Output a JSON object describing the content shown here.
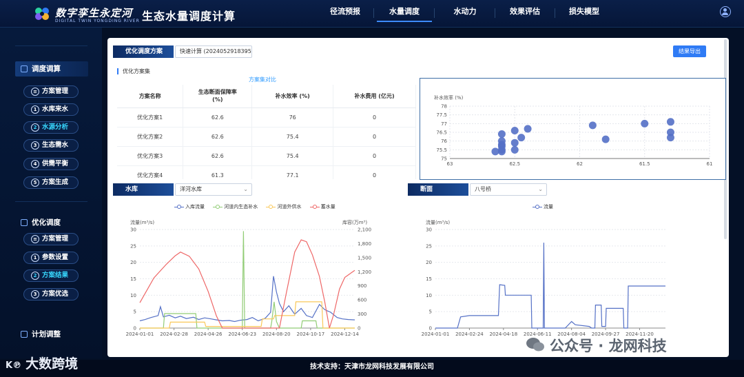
{
  "header": {
    "logo_cn": "数字孪生永定河",
    "logo_en": "DIGITAL TWIN  YONGDING RIVER",
    "system_title": "生态水量调度计算",
    "nav": [
      {
        "label": "径流预报",
        "active": false
      },
      {
        "label": "水量调度",
        "active": true
      },
      {
        "label": "水动力",
        "active": false
      },
      {
        "label": "效果评估",
        "active": false
      },
      {
        "label": "损失模型",
        "active": false
      }
    ]
  },
  "sidebar": {
    "groups": [
      {
        "label": "调度调算",
        "items": [
          {
            "badge": "",
            "label": "方案管理"
          },
          {
            "badge": "1",
            "label": "水库来水"
          },
          {
            "badge": "2",
            "label": "水源分析"
          },
          {
            "badge": "3",
            "label": "生态需水"
          },
          {
            "badge": "4",
            "label": "供需平衡"
          },
          {
            "badge": "5",
            "label": "方案生成"
          }
        ]
      },
      {
        "label": "优化调度",
        "items": [
          {
            "badge": "",
            "label": "方案管理"
          },
          {
            "badge": "1",
            "label": "参数设置"
          },
          {
            "badge": "2",
            "label": "方案结果"
          },
          {
            "badge": "3",
            "label": "方案优选"
          }
        ]
      },
      {
        "label": "计划调整",
        "items": []
      }
    ]
  },
  "main": {
    "scheme_tag": "优化调度方案",
    "scheme_select": "快速计算 (20240529183951",
    "export_button": "结果导出",
    "scheme_set_title": "优化方案集",
    "compare_link": "方案集对比",
    "table": {
      "headers": [
        "方案名称",
        "生态断面保障率\n(%)",
        "补水效率 (%)",
        "补水费用 (亿元)"
      ],
      "rows": [
        [
          "优化方案1",
          "62.6",
          "76",
          "0"
        ],
        [
          "优化方案2",
          "62.6",
          "75.4",
          "0"
        ],
        [
          "优化方案3",
          "62.6",
          "75.4",
          "0"
        ],
        [
          "优化方案4",
          "61.3",
          "77.1",
          "0"
        ]
      ]
    },
    "reservoir_tag": "水库",
    "reservoir_select": "洋河水库",
    "section_tag": "断面",
    "section_select": "八号桥"
  },
  "chart_data": [
    {
      "type": "scatter",
      "ylabel": "补水效率 (%)",
      "xlim": [
        63,
        61
      ],
      "ylim": [
        75,
        78
      ],
      "x_ticks": [
        "63",
        "62.5",
        "62",
        "61.5",
        "61"
      ],
      "y_ticks": [
        "75",
        "75.5",
        "76",
        "76.5",
        "77",
        "77.5",
        "78"
      ],
      "points": [
        {
          "x": 62.6,
          "y": 75.4
        },
        {
          "x": 62.6,
          "y": 75.5
        },
        {
          "x": 62.6,
          "y": 75.7
        },
        {
          "x": 62.6,
          "y": 75.8
        },
        {
          "x": 62.6,
          "y": 76.0
        },
        {
          "x": 62.6,
          "y": 76.4
        },
        {
          "x": 62.65,
          "y": 75.4
        },
        {
          "x": 62.5,
          "y": 75.5
        },
        {
          "x": 62.5,
          "y": 75.9
        },
        {
          "x": 62.5,
          "y": 76.6
        },
        {
          "x": 62.45,
          "y": 76.2
        },
        {
          "x": 62.4,
          "y": 76.7
        },
        {
          "x": 61.9,
          "y": 76.9
        },
        {
          "x": 61.8,
          "y": 76.1
        },
        {
          "x": 61.5,
          "y": 77.0
        },
        {
          "x": 61.3,
          "y": 77.1
        },
        {
          "x": 61.3,
          "y": 76.5
        },
        {
          "x": 61.3,
          "y": 76.2
        }
      ]
    },
    {
      "type": "line",
      "ylabel": "流量(m³/s)",
      "ylabel_right": "库容(万m³)",
      "ylim": [
        0,
        30
      ],
      "ylim_right": [
        0,
        2100
      ],
      "y_ticks": [
        "0",
        "5",
        "10",
        "15",
        "20",
        "25",
        "30"
      ],
      "y_ticks_right": [
        "0",
        "300",
        "600",
        "900",
        "1,200",
        "1,500",
        "1,800",
        "2,100"
      ],
      "x_ticks": [
        "2024-01-01",
        "2024-02-28",
        "2024-04-26",
        "2024-06-23",
        "2024-08-20",
        "2024-10-17",
        "2024-12-14"
      ],
      "x_range": [
        "2024-01-01",
        "2024-12-31"
      ],
      "series": [
        {
          "name": "入库流量",
          "color": "#5470c6",
          "axis": "left",
          "points": [
            [
              "2024-01-01",
              2.2
            ],
            [
              "2024-01-10",
              2.6
            ],
            [
              "2024-01-20",
              3.2
            ],
            [
              "2024-02-01",
              3.8
            ],
            [
              "2024-02-05",
              6.5
            ],
            [
              "2024-02-10",
              3.4
            ],
            [
              "2024-02-20",
              3.9
            ],
            [
              "2024-03-01",
              3.1
            ],
            [
              "2024-03-10",
              3.6
            ],
            [
              "2024-03-20",
              2.9
            ],
            [
              "2024-04-01",
              3.3
            ],
            [
              "2024-04-10",
              2.6
            ],
            [
              "2024-04-20",
              3.1
            ],
            [
              "2024-05-01",
              2.8
            ],
            [
              "2024-05-10",
              2.5
            ],
            [
              "2024-05-20",
              2.2
            ],
            [
              "2024-06-01",
              2.3
            ],
            [
              "2024-06-10",
              2.0
            ],
            [
              "2024-06-20",
              2.4
            ],
            [
              "2024-07-01",
              2.6
            ],
            [
              "2024-07-10",
              3.2
            ],
            [
              "2024-07-20",
              2.2
            ],
            [
              "2024-08-01",
              3.0
            ],
            [
              "2024-08-10",
              4.8
            ],
            [
              "2024-08-15",
              15.8
            ],
            [
              "2024-08-20",
              11.0
            ],
            [
              "2024-08-25",
              7.5
            ],
            [
              "2024-09-01",
              5.0
            ],
            [
              "2024-09-10",
              6.8
            ],
            [
              "2024-09-20",
              4.2
            ],
            [
              "2024-10-01",
              6.0
            ],
            [
              "2024-10-10",
              3.8
            ],
            [
              "2024-10-20",
              3.2
            ],
            [
              "2024-11-01",
              7.2
            ],
            [
              "2024-11-10",
              5.6
            ],
            [
              "2024-11-20",
              4.8
            ],
            [
              "2024-12-01",
              3.2
            ],
            [
              "2024-12-10",
              2.8
            ],
            [
              "2024-12-20",
              2.6
            ],
            [
              "2024-12-31",
              2.5
            ]
          ]
        },
        {
          "name": "河道内生态补水",
          "color": "#91cc75",
          "axis": "left",
          "points": [
            [
              "2024-01-01",
              0
            ],
            [
              "2024-02-10",
              0
            ],
            [
              "2024-02-12",
              4.4
            ],
            [
              "2024-04-05",
              4.4
            ],
            [
              "2024-04-07",
              0
            ],
            [
              "2024-06-23",
              0
            ],
            [
              "2024-06-25",
              29.5
            ],
            [
              "2024-06-27",
              0
            ],
            [
              "2024-08-10",
              0
            ],
            [
              "2024-08-12",
              2.0
            ],
            [
              "2024-08-16",
              8.0
            ],
            [
              "2024-08-20",
              2.0
            ],
            [
              "2024-08-25",
              0
            ],
            [
              "2024-10-01",
              0
            ],
            [
              "2024-10-03",
              2.2
            ],
            [
              "2024-10-26",
              2.2
            ],
            [
              "2024-10-28",
              0
            ],
            [
              "2024-12-31",
              0
            ]
          ]
        },
        {
          "name": "河道外供水",
          "color": "#fac858",
          "axis": "left",
          "points": [
            [
              "2024-01-01",
              0
            ],
            [
              "2024-02-20",
              0
            ],
            [
              "2024-02-22",
              1.8
            ],
            [
              "2024-04-20",
              1.8
            ],
            [
              "2024-04-22",
              0.5
            ],
            [
              "2024-07-25",
              0.5
            ],
            [
              "2024-07-27",
              2.8
            ],
            [
              "2024-08-15",
              2.8
            ],
            [
              "2024-08-17",
              3.8
            ],
            [
              "2024-09-20",
              3.8
            ],
            [
              "2024-09-22",
              8.0
            ],
            [
              "2024-11-05",
              8.0
            ],
            [
              "2024-11-07",
              0
            ],
            [
              "2024-12-31",
              0
            ]
          ]
        },
        {
          "name": "蓄水量",
          "color": "#ee6666",
          "axis": "right",
          "points": [
            [
              "2024-01-01",
              540
            ],
            [
              "2024-01-25",
              1070
            ],
            [
              "2024-02-15",
              1360
            ],
            [
              "2024-03-01",
              1540
            ],
            [
              "2024-03-10",
              1620
            ],
            [
              "2024-03-25",
              1530
            ],
            [
              "2024-04-10",
              1260
            ],
            [
              "2024-04-26",
              780
            ],
            [
              "2024-05-10",
              260
            ],
            [
              "2024-05-20",
              0
            ],
            [
              "2024-08-25",
              0
            ],
            [
              "2024-09-05",
              700
            ],
            [
              "2024-09-20",
              1620
            ],
            [
              "2024-10-01",
              1880
            ],
            [
              "2024-10-10",
              1840
            ],
            [
              "2024-10-20",
              1560
            ],
            [
              "2024-11-01",
              1100
            ],
            [
              "2024-11-10",
              560
            ],
            [
              "2024-11-18",
              0
            ],
            [
              "2024-11-25",
              280
            ],
            [
              "2024-12-05",
              830
            ],
            [
              "2024-12-14",
              1080
            ],
            [
              "2024-12-31",
              1230
            ]
          ]
        }
      ]
    },
    {
      "type": "line",
      "ylabel": "流量(m³/s)",
      "ylim": [
        0,
        30
      ],
      "y_ticks": [
        "0",
        "5",
        "10",
        "15",
        "20",
        "25",
        "30"
      ],
      "x_ticks": [
        "2024-01-01",
        "2024-02-24",
        "2024-04-18",
        "2024-06-11",
        "2024-08-04",
        "2024-09-27",
        "2024-11-20"
      ],
      "x_range": [
        "2024-01-01",
        "2024-12-31"
      ],
      "series": [
        {
          "name": "流量",
          "color": "#5470c6",
          "points": [
            [
              "2024-01-01",
              0
            ],
            [
              "2024-02-05",
              0
            ],
            [
              "2024-02-10",
              3.4
            ],
            [
              "2024-02-24",
              3.8
            ],
            [
              "2024-04-10",
              3.8
            ],
            [
              "2024-04-12",
              13.2
            ],
            [
              "2024-04-20",
              13.0
            ],
            [
              "2024-04-21",
              10.0
            ],
            [
              "2024-06-01",
              10.0
            ],
            [
              "2024-06-02",
              0
            ],
            [
              "2024-06-20",
              0
            ],
            [
              "2024-06-21",
              26.0
            ],
            [
              "2024-06-22",
              0
            ],
            [
              "2024-07-25",
              0
            ],
            [
              "2024-08-04",
              2.0
            ],
            [
              "2024-08-10",
              1.0
            ],
            [
              "2024-09-01",
              0.5
            ],
            [
              "2024-09-05",
              0
            ],
            [
              "2024-09-10",
              0
            ],
            [
              "2024-09-11",
              7.0
            ],
            [
              "2024-09-20",
              7.0
            ],
            [
              "2024-09-21",
              0.5
            ],
            [
              "2024-09-27",
              0.5
            ],
            [
              "2024-09-28",
              6.0
            ],
            [
              "2024-10-25",
              6.0
            ],
            [
              "2024-10-26",
              0
            ],
            [
              "2024-11-01",
              0
            ],
            [
              "2024-11-02",
              12.8
            ],
            [
              "2024-12-31",
              12.8
            ]
          ]
        }
      ]
    }
  ],
  "footer": {
    "text": "技术支持：天津市龙网科技发展有限公司"
  },
  "watermarks": {
    "left": "大数跨境",
    "right": "公众号 · 龙网科技"
  }
}
